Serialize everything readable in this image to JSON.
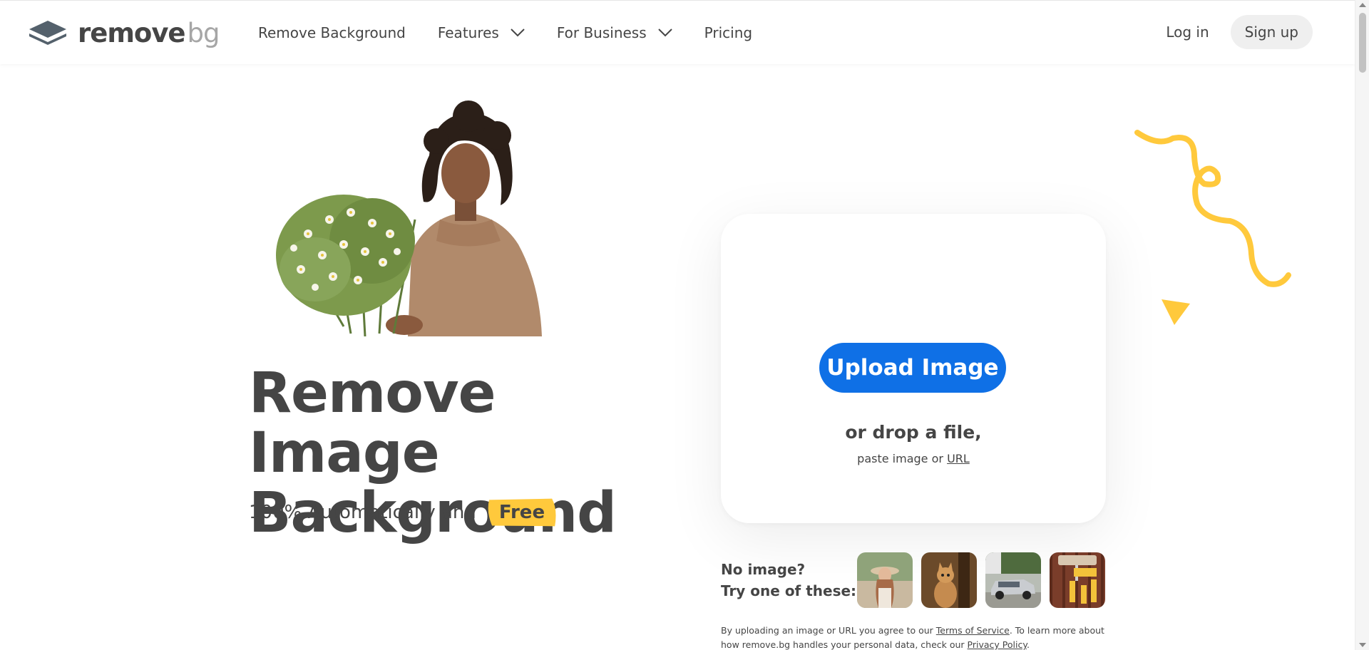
{
  "header": {
    "logo": {
      "word1": "remove",
      "word2": "bg"
    },
    "nav": [
      {
        "label": "Remove Background",
        "has_dropdown": false
      },
      {
        "label": "Features",
        "has_dropdown": true
      },
      {
        "label": "For Business",
        "has_dropdown": true
      },
      {
        "label": "Pricing",
        "has_dropdown": false
      }
    ],
    "login_label": "Log in",
    "signup_label": "Sign up"
  },
  "hero": {
    "title_line1": "Remove Image",
    "title_line2": "Background",
    "subtitle": "100% Automatically and",
    "badge": "Free",
    "badge_color": "#ffc93c"
  },
  "upload": {
    "button_label": "Upload Image",
    "drop_text": "or drop a file,",
    "paste_prefix": "paste image or",
    "paste_link": "URL"
  },
  "samples": {
    "line1": "No image?",
    "line2": "Try one of these:",
    "items": [
      {
        "icon": "woman-hat-photo"
      },
      {
        "icon": "cat-photo"
      },
      {
        "icon": "car-photo"
      },
      {
        "icon": "paint-roller-photo"
      }
    ]
  },
  "legal": {
    "part1": "By uploading an image or URL you agree to our",
    "terms": "Terms of Service",
    "part2": ". To learn more about how remove.bg handles your personal data, check our",
    "privacy": "Privacy Policy",
    "part3": "."
  },
  "colors": {
    "accent": "#0f70e6",
    "text": "#454545",
    "decor": "#ffc93c"
  }
}
